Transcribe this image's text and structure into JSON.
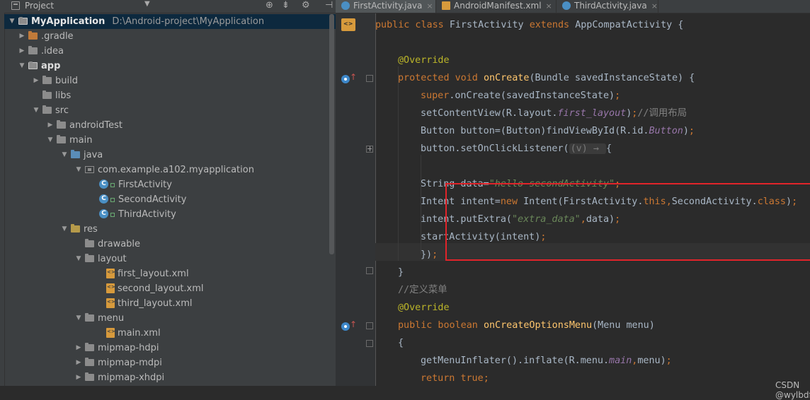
{
  "project_panel": {
    "title": "Project",
    "tree": [
      {
        "label": "MyApplication",
        "path": "D:\\Android-project\\MyApplication"
      },
      {
        "label": ".gradle"
      },
      {
        "label": ".idea"
      },
      {
        "label": "app"
      },
      {
        "label": "build"
      },
      {
        "label": "libs"
      },
      {
        "label": "src"
      },
      {
        "label": "androidTest"
      },
      {
        "label": "main"
      },
      {
        "label": "java"
      },
      {
        "label": "com.example.a102.myapplication"
      },
      {
        "label": "FirstActivity"
      },
      {
        "label": "SecondActivity"
      },
      {
        "label": "ThirdActivity"
      },
      {
        "label": "res"
      },
      {
        "label": "drawable"
      },
      {
        "label": "layout"
      },
      {
        "label": "first_layout.xml"
      },
      {
        "label": "second_layout.xml"
      },
      {
        "label": "third_layout.xml"
      },
      {
        "label": "menu"
      },
      {
        "label": "main.xml"
      },
      {
        "label": "mipmap-hdpi"
      },
      {
        "label": "mipmap-mdpi"
      },
      {
        "label": "mipmap-xhdpi"
      }
    ]
  },
  "tabs": [
    {
      "label": "FirstActivity.java",
      "active": true
    },
    {
      "label": "AndroidManifest.xml",
      "active": false
    },
    {
      "label": "ThirdActivity.java",
      "active": false
    }
  ],
  "code": {
    "l1": {
      "a": "public class ",
      "b": "FirstActivity ",
      "c": "extends ",
      "d": "AppCompatActivity {"
    },
    "l3": {
      "a": "@Override"
    },
    "l4": {
      "a": "protected void ",
      "b": "onCreate",
      "c": "(Bundle savedInstanceState) {"
    },
    "l5": {
      "a": "super",
      "b": ".onCreate(savedInstanceState)",
      "c": ";"
    },
    "l6": {
      "a": "setContentView(R.layout.",
      "b": "first_layout",
      "c": ")",
      "d": ";",
      "e": "//调用布局"
    },
    "l7": {
      "a": "Button button=(Button)findViewById(R.id.",
      "b": "Button",
      "c": ")",
      "d": ";"
    },
    "l8": {
      "a": "button.setOnClickListener(",
      "b": "(v) → ",
      "c": "{"
    },
    "l10": {
      "a": "String data=",
      "b": "\"hello secondActivity\"",
      "c": ";"
    },
    "l11": {
      "a": "Intent intent=",
      "b": "new ",
      "c": "Intent(FirstActivity.",
      "d": "this",
      "e": ",",
      "f": "SecondActivity.",
      "g": "class",
      "h": ")",
      "i": ";"
    },
    "l12": {
      "a": "intent.putExtra(",
      "b": "\"extra_data\"",
      "c": ",",
      "d": "data)",
      "e": ";"
    },
    "l13": {
      "a": "startActivity(intent)",
      "b": ";"
    },
    "l14": {
      "a": "})",
      "b": ";"
    },
    "l15": {
      "a": "}"
    },
    "l16": {
      "a": "//定义菜单"
    },
    "l17": {
      "a": "@Override"
    },
    "l18": {
      "a": "public boolean ",
      "b": "onCreateOptionsMenu",
      "c": "(Menu menu)"
    },
    "l19": {
      "a": "{"
    },
    "l20": {
      "a": "getMenuInflater().inflate(R.menu.",
      "b": "main",
      "c": ",",
      "d": "menu)",
      "e": ";"
    },
    "l21": {
      "a": "return ",
      "b": "true",
      "c": ";"
    }
  },
  "watermark": "CSDN @wylbdff"
}
